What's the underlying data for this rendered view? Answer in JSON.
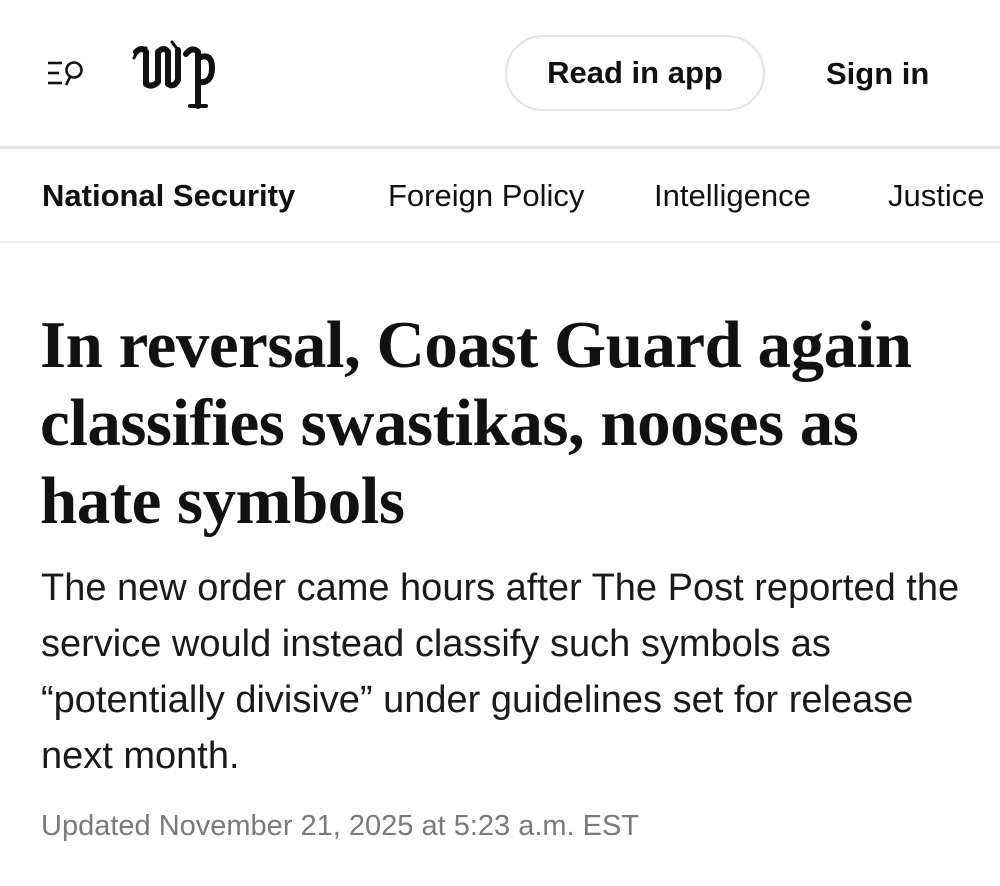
{
  "header": {
    "menu_icon": "menu-search-icon",
    "logo_icon": "wp-logo-icon",
    "read_in_app_label": "Read in app",
    "sign_in_label": "Sign in"
  },
  "nav": {
    "items": [
      {
        "label": "National Security",
        "active": true
      },
      {
        "label": "Foreign Policy",
        "active": false
      },
      {
        "label": "Intelligence",
        "active": false
      },
      {
        "label": "Justice",
        "active": false
      }
    ]
  },
  "article": {
    "headline": "In reversal, Coast Guard again classifies swastikas, nooses as hate symbols",
    "dek": "The new order came hours after The Post reported the service would instead classify such symbols as “potentially divisive” under guidelines set for release next month.",
    "timestamp": "Updated November 21, 2025 at 5:23 a.m. EST"
  },
  "colors": {
    "text": "#111111",
    "timestamp": "#7a7a7a",
    "divider": "#e6e6e6",
    "button_border": "#e3e3e3"
  }
}
